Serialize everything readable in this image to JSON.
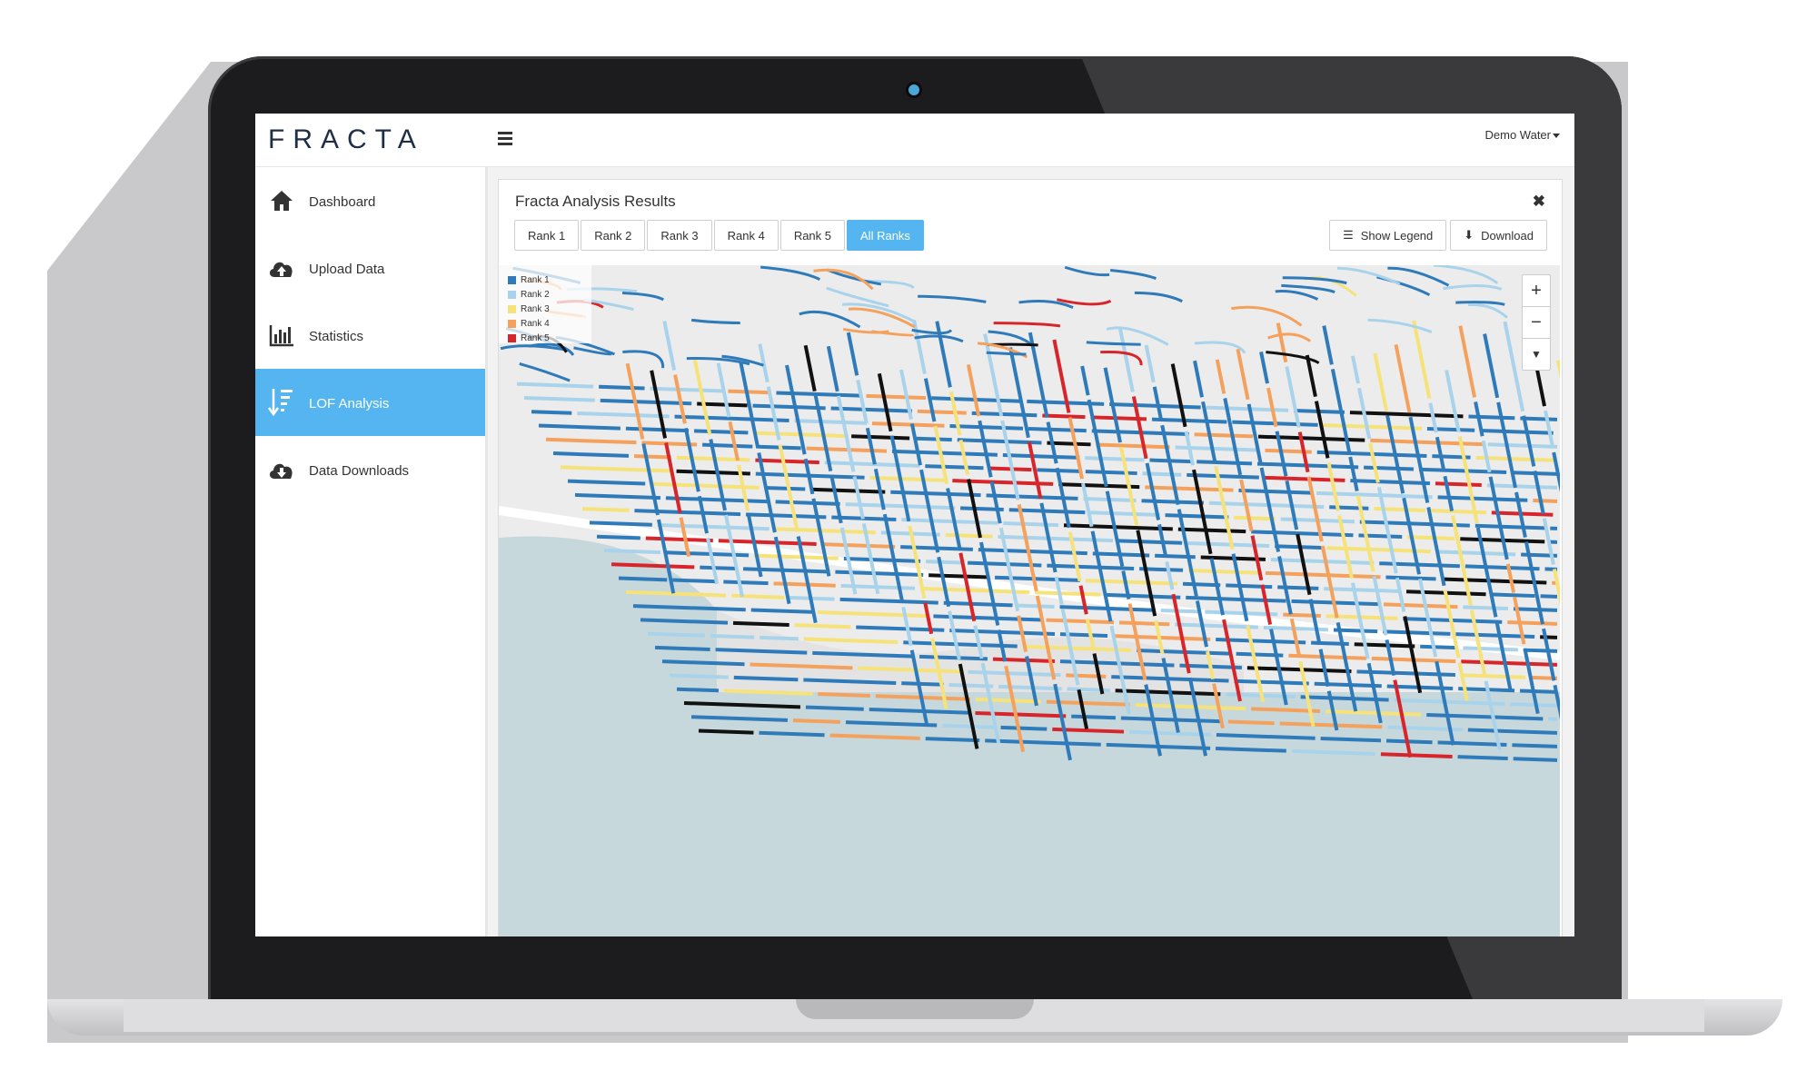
{
  "app": {
    "logo_text": "FRACTA"
  },
  "header": {
    "user_label": "Demo Water"
  },
  "sidebar": {
    "items": [
      {
        "label": "Dashboard",
        "icon": "home-icon",
        "active": false
      },
      {
        "label": "Upload Data",
        "icon": "cloud-upload-icon",
        "active": false
      },
      {
        "label": "Statistics",
        "icon": "bar-chart-icon",
        "active": false
      },
      {
        "label": "LOF Analysis",
        "icon": "sort-list-icon",
        "active": true
      },
      {
        "label": "Data Downloads",
        "icon": "cloud-download-icon",
        "active": false
      }
    ]
  },
  "panel": {
    "title": "Fracta Analysis Results",
    "close_symbol": "✖",
    "tabs": [
      "Rank 1",
      "Rank 2",
      "Rank 3",
      "Rank 4",
      "Rank 5",
      "All Ranks"
    ],
    "active_tab": "All Ranks",
    "show_legend_label": "Show Legend",
    "download_label": "Download"
  },
  "map": {
    "legend": [
      {
        "label": "Rank 1",
        "color": "#2f7ab9"
      },
      {
        "label": "Rank 2",
        "color": "#a9d3ea"
      },
      {
        "label": "Rank 3",
        "color": "#f5e27a"
      },
      {
        "label": "Rank 4",
        "color": "#f4a15d"
      },
      {
        "label": "Rank 5",
        "color": "#d7262b"
      }
    ],
    "zoom_in": "+",
    "zoom_out": "−",
    "compass": "▼",
    "background": "#ececec",
    "water_color": "#c7d8dd",
    "rank_colors": [
      "#2f7ab9",
      "#a9d3ea",
      "#f5e27a",
      "#f4a15d",
      "#d7262b",
      "#111111"
    ]
  },
  "colors": {
    "accent": "#55b5f0",
    "frame": "#1c1c1e"
  }
}
